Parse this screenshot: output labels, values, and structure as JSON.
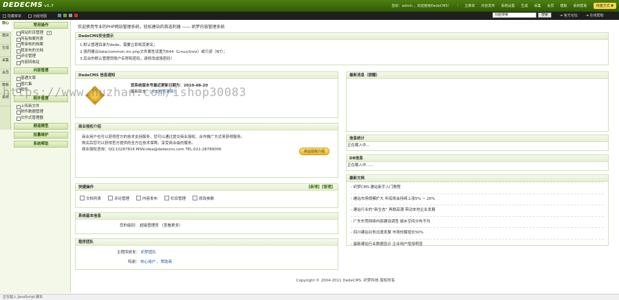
{
  "header": {
    "logo": "DEDECMS",
    "version": "v5.7",
    "nav": [
      "您好：admin ，欢迎使用DedeCMS！",
      "主菜单",
      "内容发布",
      "系统设置",
      "生成",
      "采集",
      "会员",
      "模板",
      "系统帮助"
    ],
    "quick_label": "快捷方式 ▼"
  },
  "subbar": {
    "items": [
      "隐藏菜单",
      "功能地图"
    ]
  },
  "search": {
    "value": "功能搜索",
    "button": "搜索",
    "links": [
      "官方论坛",
      "在线帮助"
    ]
  },
  "sidebar": {
    "tabs": [
      "核心",
      "模块",
      "生成",
      "采集",
      "会员",
      "模板",
      "系统"
    ],
    "sections": [
      {
        "title": "常用操作",
        "items": [
          "网站栏目管理",
          "所有档案列表",
          "等审核的档案",
          "我发布的文档",
          "评论管理",
          "内容回收站"
        ]
      },
      {
        "title": "内容管理",
        "items": [
          "普通文章",
          "图片集",
          "软件"
        ]
      },
      {
        "title": "附件管理",
        "items": [
          "上传新文件",
          "附件数据管理",
          "文件式管理器"
        ]
      },
      {
        "title": "频道模型",
        "items": []
      },
      {
        "title": "批量维护",
        "items": []
      },
      {
        "title": "系统帮助",
        "items": []
      }
    ]
  },
  "main": {
    "site_title": "欢迎使用专业的PHP网站管理系统，轻松建站的首选利器 —— 织梦内容管理系统",
    "security": {
      "title": "DedeCMS安全提示",
      "lines": [
        "1.默认管理目录为dede，需要立即将其更名；",
        "2.强烈建议data/common.inc.php文件属性设置为644（Linux/Unix）或只读（NT）；",
        "3.后台的默认管理员账户名称和密码，请修改成强密码！"
      ]
    },
    "info": {
      "title": "DedeCMS 信息通知",
      "line1": "您系统版本号最近更新日期为：2010-08-20",
      "line2": "最新版本：",
      "line2_link": "[点击检查更新]"
    },
    "news": {
      "title": "最新消息（提醒）"
    },
    "business": {
      "title": "商业授权介绍",
      "lines": [
        "商业用户也可以获得官方的技术支持服务，您可以通过提交商业授权、合作推广方式来获得服务。",
        "购买后您可以获得官方提供的全方位技术保障，享受商业级的服务。",
        "商业授权咨询：QQ:10287816 MSN:idea@dedecms.com TEL:021-28789006"
      ],
      "button": "商业授权介绍"
    },
    "stats": {
      "title": "信息统计",
      "line": "正在载入中..."
    },
    "dbinfo": {
      "title": "DB信息",
      "line": "正在载入中……"
    },
    "quick": {
      "title": "快捷操作",
      "links": "【新增】【管理】",
      "items": [
        "文档列表",
        "评论管理",
        "内容发布",
        "栏目管理",
        "修改参数"
      ]
    },
    "sysinfo": {
      "title": "系统基本信息",
      "label": "您的级别：",
      "value": "超级管理员 （查看更多）"
    },
    "team": {
      "title": "程序团队",
      "rows": [
        {
          "label": "主程序研发：",
          "value": "织梦团队"
        },
        {
          "label": "鸣谢：",
          "value": "热心用户 、赞助商"
        }
      ]
    },
    "docs": {
      "title": "最新文档",
      "items": [
        "- 织梦CMS 建站新手入门教程",
        "- 建站市场规模扩大 年底将会持续上涨5% ~ 20%",
        "- 建站行业的“新生态” 再掀高潮 带动本地企业发展",
        "- 广东东莞网络内容建设调查 城乡空间分布不均",
        "- 四川建站业务迅速发展 市场份额增长50%",
        "- 最新建站行业数据显示 企业用户增加明显"
      ]
    }
  },
  "footer": "Copyright © 2004-2011 DedeCMS. 织梦科技 版权所有",
  "status": "正在载入 JavaScript 脚本",
  "watermark": "https://www.huzhan.com/ishop30083"
}
